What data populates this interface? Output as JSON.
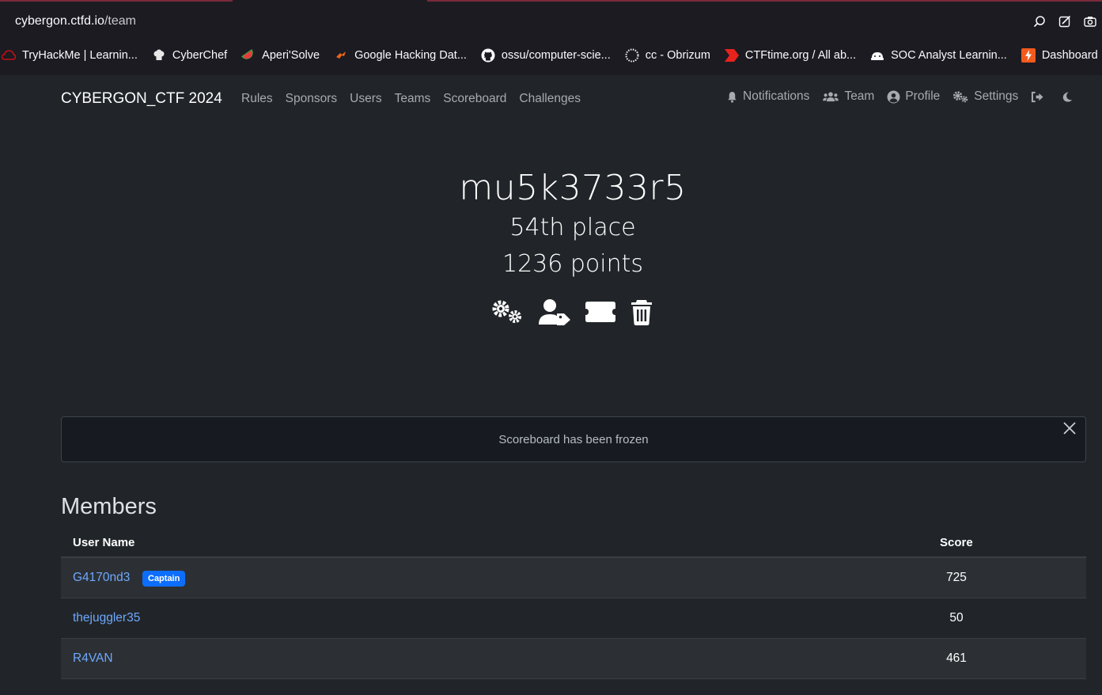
{
  "browser": {
    "url_host": "cybergon.ctfd.io",
    "url_path": "/team",
    "bookmarks": [
      {
        "label": "TryHackMe | Learnin...",
        "icon": "tryhackme-icon"
      },
      {
        "label": "CyberChef",
        "icon": "chef-hat-icon"
      },
      {
        "label": "Aperi'Solve",
        "icon": "watermelon-icon"
      },
      {
        "label": "Google Hacking Dat...",
        "icon": "exploit-db-icon"
      },
      {
        "label": "ossu/computer-scie...",
        "icon": "github-icon"
      },
      {
        "label": "cc - Obrizum",
        "icon": "dotted-circle-icon"
      },
      {
        "label": "CTFtime.org / All ab...",
        "icon": "ctftime-flag-icon"
      },
      {
        "label": "SOC Analyst Learnin...",
        "icon": "soc-icon"
      },
      {
        "label": "Dashboard",
        "icon": "dashboard-bolt-icon"
      }
    ]
  },
  "nav": {
    "brand": "CYBERGON_CTF 2024",
    "left": [
      "Rules",
      "Sponsors",
      "Users",
      "Teams",
      "Scoreboard",
      "Challenges"
    ],
    "notifications": "Notifications",
    "team": "Team",
    "profile": "Profile",
    "settings": "Settings"
  },
  "team": {
    "name": "mu5k3733r5",
    "place": "54th place",
    "points": "1236 points"
  },
  "alert": {
    "text": "Scoreboard has been frozen"
  },
  "members": {
    "title": "Members",
    "columns": {
      "user": "User Name",
      "score": "Score"
    },
    "rows": [
      {
        "name": "G4170nd3",
        "badge": "Captain",
        "score": "725"
      },
      {
        "name": "thejuggler35",
        "badge": "",
        "score": "50"
      },
      {
        "name": "R4VAN",
        "badge": "",
        "score": "461"
      }
    ]
  },
  "colors": {
    "background": "#212529",
    "link": "#6ea8fe",
    "badge": "#0d6efd",
    "chrome": "#1c1b22"
  }
}
